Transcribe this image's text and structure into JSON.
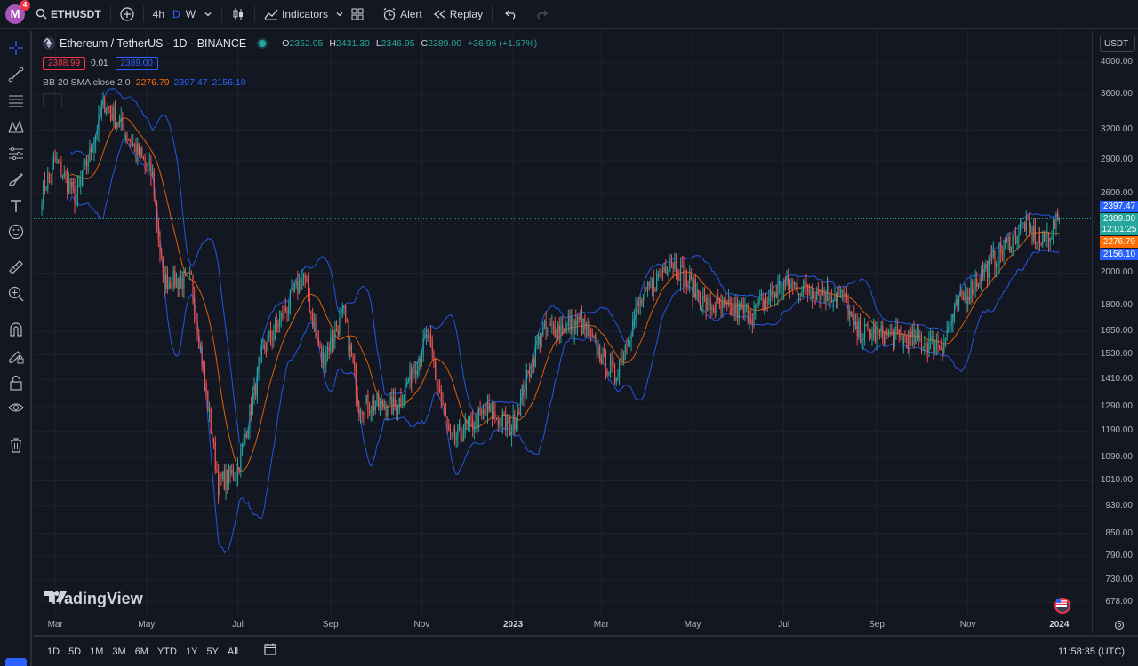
{
  "topbar": {
    "avatar_letter": "M",
    "notif_count": "4",
    "symbol": "ETHUSDT",
    "tf_4h": "4h",
    "tf_d": "D",
    "tf_w": "W",
    "indicators": "Indicators",
    "alert": "Alert",
    "replay": "Replay"
  },
  "legend": {
    "title": "Ethereum / TetherUS · 1D · BINANCE",
    "o_label": "O",
    "o": "2352.05",
    "h_label": "H",
    "h": "2431.30",
    "l_label": "L",
    "l": "2346.95",
    "c_label": "C",
    "c": "2389.00",
    "change": "+36.96 (+1.57%)",
    "bid": "2388.99",
    "spread": "0.01",
    "ask": "2389.00",
    "bb_name": "BB 20 SMA close 2 0",
    "bb_basis": "2276.79",
    "bb_upper": "2397.47",
    "bb_lower": "2156.10"
  },
  "price_scale": {
    "currency": "USDT",
    "labels": [
      "4000.00",
      "3600.00",
      "3200.00",
      "2900.00",
      "2600.00",
      "2000.00",
      "1800.00",
      "1650.00",
      "1530.00",
      "1410.00",
      "1290.00",
      "1190.00",
      "1090.00",
      "1010.00",
      "930.00",
      "850.00",
      "790.00",
      "730.00",
      "678.00"
    ],
    "tag_upper": "2397.47",
    "tag_price": "2389.00",
    "tag_countdown": "12:01:25",
    "tag_basis": "2276.79",
    "tag_lower": "2156.10"
  },
  "time_scale": {
    "labels": [
      "Mar",
      "May",
      "Jul",
      "Sep",
      "Nov",
      "2023",
      "Mar",
      "May",
      "Jul",
      "Sep",
      "Nov",
      "2024"
    ]
  },
  "bottom": {
    "ranges": [
      "1D",
      "5D",
      "1M",
      "3M",
      "6M",
      "YTD",
      "1Y",
      "5Y",
      "All"
    ],
    "clock": "11:58:35 (UTC)"
  },
  "watermark": "TradingView",
  "colors": {
    "up": "#26a69a",
    "down": "#ef5350",
    "band": "#2962ff",
    "basis": "#ff6d00",
    "bg": "#131722"
  },
  "chart_data": {
    "type": "candlestick",
    "symbol": "ETHUSDT",
    "interval": "1D",
    "scale": "log",
    "ylim": [
      678,
      4000
    ],
    "x_ticks": [
      "Mar",
      "May",
      "Jul",
      "Sep",
      "Nov",
      "2023",
      "Mar",
      "May",
      "Jul",
      "Sep",
      "Nov",
      "2024"
    ],
    "approx_daily_close_path": [
      {
        "date": "2022-02-20",
        "close": 2600
      },
      {
        "date": "2022-03-01",
        "close": 2900
      },
      {
        "date": "2022-03-15",
        "close": 2550
      },
      {
        "date": "2022-04-03",
        "close": 3500
      },
      {
        "date": "2022-04-20",
        "close": 3100
      },
      {
        "date": "2022-05-05",
        "close": 2750
      },
      {
        "date": "2022-05-12",
        "close": 1950
      },
      {
        "date": "2022-05-31",
        "close": 1950
      },
      {
        "date": "2022-06-13",
        "close": 1200
      },
      {
        "date": "2022-06-18",
        "close": 1000
      },
      {
        "date": "2022-07-01",
        "close": 1050
      },
      {
        "date": "2022-07-18",
        "close": 1550
      },
      {
        "date": "2022-08-14",
        "close": 1980
      },
      {
        "date": "2022-08-26",
        "close": 1500
      },
      {
        "date": "2022-09-10",
        "close": 1750
      },
      {
        "date": "2022-09-20",
        "close": 1300
      },
      {
        "date": "2022-10-15",
        "close": 1290
      },
      {
        "date": "2022-11-05",
        "close": 1620
      },
      {
        "date": "2022-11-20",
        "close": 1150
      },
      {
        "date": "2022-12-15",
        "close": 1270
      },
      {
        "date": "2022-12-31",
        "close": 1200
      },
      {
        "date": "2023-01-20",
        "close": 1650
      },
      {
        "date": "2023-02-15",
        "close": 1700
      },
      {
        "date": "2023-03-10",
        "close": 1420
      },
      {
        "date": "2023-03-25",
        "close": 1780
      },
      {
        "date": "2023-04-16",
        "close": 2100
      },
      {
        "date": "2023-05-10",
        "close": 1800
      },
      {
        "date": "2023-06-10",
        "close": 1750
      },
      {
        "date": "2023-07-01",
        "close": 1930
      },
      {
        "date": "2023-08-10",
        "close": 1850
      },
      {
        "date": "2023-08-18",
        "close": 1650
      },
      {
        "date": "2023-09-15",
        "close": 1620
      },
      {
        "date": "2023-10-15",
        "close": 1580
      },
      {
        "date": "2023-10-25",
        "close": 1800
      },
      {
        "date": "2023-11-15",
        "close": 2050
      },
      {
        "date": "2023-12-09",
        "close": 2350
      },
      {
        "date": "2023-12-20",
        "close": 2200
      },
      {
        "date": "2024-01-01",
        "close": 2389
      }
    ]
  }
}
